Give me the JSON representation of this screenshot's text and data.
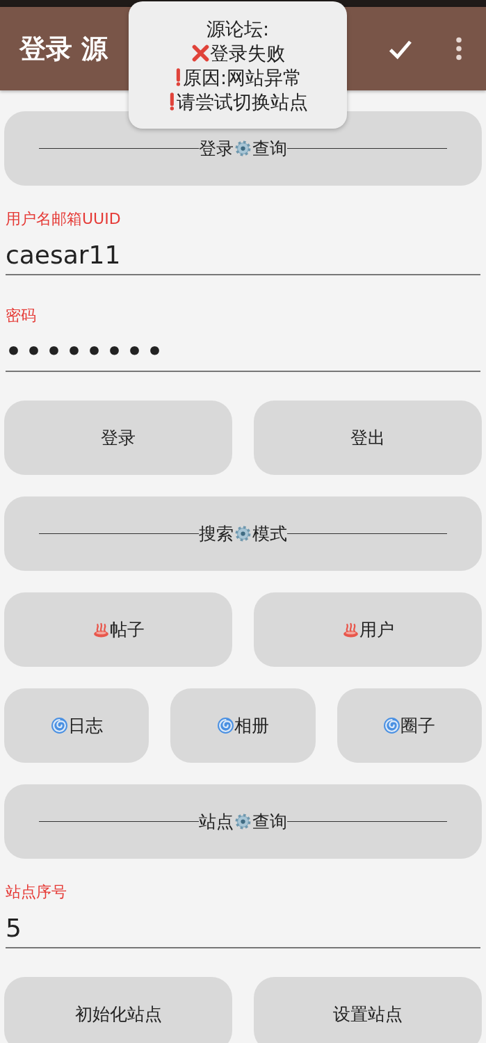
{
  "app_bar": {
    "title": "登录 源",
    "actions": [
      {
        "kind": "check"
      },
      {
        "kind": "overflow"
      }
    ]
  },
  "toast": {
    "lines": [
      {
        "kind": "plain",
        "text": "源论坛:"
      },
      {
        "kind": "cross",
        "text": "登录失败"
      },
      {
        "kind": "exclamation",
        "text": "原因:网站异常"
      },
      {
        "kind": "exclamation",
        "text": "请尝试切换站点"
      }
    ]
  },
  "content": [
    {
      "kind": "section",
      "left": "登录",
      "right": "查询"
    },
    {
      "kind": "field",
      "label": "用户名邮箱UUID",
      "value": "caesar11"
    },
    {
      "kind": "password",
      "label": "密码",
      "value": "••••••••"
    },
    {
      "kind": "buttons",
      "buttons": [
        {
          "kind": "plain",
          "label": "登录"
        },
        {
          "kind": "plain",
          "label": "登出"
        }
      ]
    },
    {
      "kind": "section",
      "left": "搜索",
      "right": "模式"
    },
    {
      "kind": "buttons",
      "buttons": [
        {
          "kind": "hotspring",
          "label": "帖子"
        },
        {
          "kind": "hotspring",
          "label": "用户"
        }
      ]
    },
    {
      "kind": "buttons",
      "buttons": [
        {
          "kind": "cyclone",
          "label": "日志"
        },
        {
          "kind": "cyclone",
          "label": "相册"
        },
        {
          "kind": "cyclone",
          "label": "圈子"
        }
      ]
    },
    {
      "kind": "section",
      "left": "站点",
      "right": "查询"
    },
    {
      "kind": "field",
      "label": "站点序号",
      "value": "5"
    },
    {
      "kind": "buttons",
      "buttons": [
        {
          "kind": "plain",
          "label": "初始化站点"
        },
        {
          "kind": "plain",
          "label": "设置站点"
        }
      ]
    }
  ]
}
